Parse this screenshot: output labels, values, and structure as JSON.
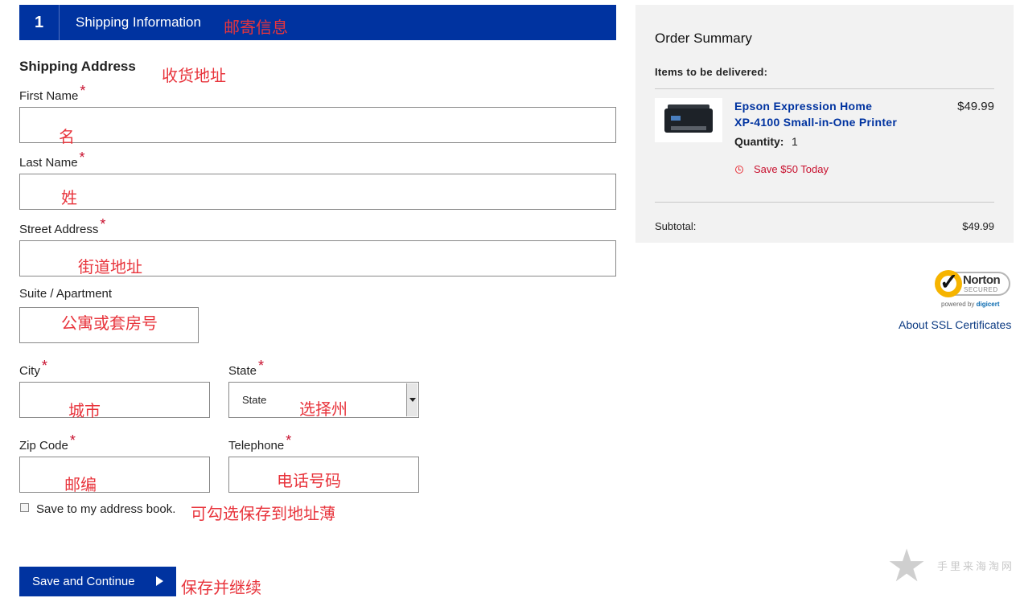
{
  "section": {
    "step": "1",
    "title": "Shipping Information",
    "title_note": "邮寄信息"
  },
  "form": {
    "heading": "Shipping Address",
    "heading_note": "收货地址",
    "required_mark": "*",
    "first_name": {
      "label": "First Name",
      "note": "名",
      "value": ""
    },
    "last_name": {
      "label": "Last Name",
      "note": "姓",
      "value": ""
    },
    "street": {
      "label": "Street Address",
      "note": "街道地址",
      "value": ""
    },
    "suite": {
      "label": "Suite / Apartment",
      "note": "公寓或套房号",
      "value": ""
    },
    "city": {
      "label": "City",
      "note": "城市",
      "value": ""
    },
    "state": {
      "label": "State",
      "note": "选择州",
      "selected": "State"
    },
    "zip": {
      "label": "Zip Code",
      "note": "邮编",
      "value": ""
    },
    "phone": {
      "label": "Telephone",
      "note": "电话号码",
      "value": ""
    },
    "save_checkbox": {
      "label": "Save to my address book.",
      "note": "可勾选保存到地址薄",
      "checked": false
    },
    "continue_button": {
      "label": "Save and Continue",
      "note": "保存并继续"
    }
  },
  "order_summary": {
    "title": "Order Summary",
    "items_label": "Items to be delivered:",
    "item": {
      "name_line1": "Epson Expression Home",
      "name_line2": "XP-4100 Small-in-One Printer",
      "price": "$49.99",
      "quantity_label": "Quantity:",
      "quantity": "1",
      "savings": "Save $50 Today"
    },
    "subtotal_label": "Subtotal:",
    "subtotal_value": "$49.99"
  },
  "trust": {
    "badge_word": "Norton",
    "badge_secured": "SECURED",
    "badge_powered": "powered by",
    "badge_brand": "digicert",
    "ssl_link": "About SSL Certificates"
  },
  "watermark": {
    "text": "手里来海淘网"
  },
  "colors": {
    "brand_blue": "#0033a0",
    "annotation_red": "#e8343c",
    "required_red": "#c8102e",
    "summary_bg": "#f2f2f2"
  }
}
